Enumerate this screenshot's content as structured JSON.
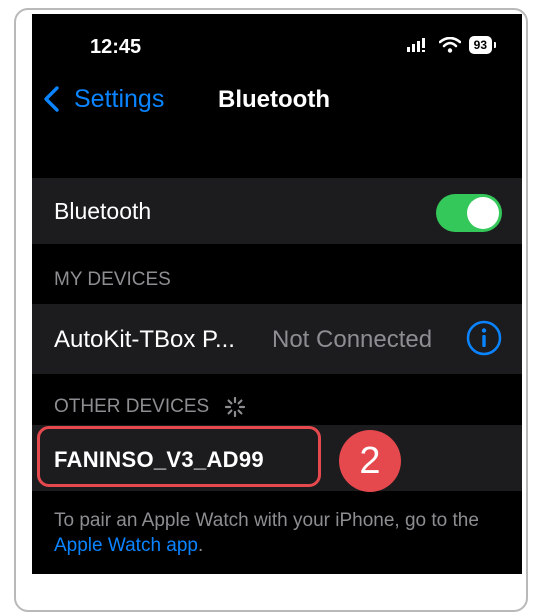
{
  "status_bar": {
    "time": "12:45",
    "battery": "93",
    "signal_icon": "signal-bars-icon",
    "wifi_icon": "wifi-icon"
  },
  "nav": {
    "back_label": "Settings",
    "title": "Bluetooth"
  },
  "bluetooth_row": {
    "label": "Bluetooth",
    "toggle_on": true
  },
  "my_devices": {
    "header": "MY DEVICES",
    "items": [
      {
        "name": "AutoKit-TBox P...",
        "status": "Not Connected"
      }
    ]
  },
  "other_devices": {
    "header": "OTHER DEVICES",
    "items": [
      {
        "name": "FANINSO_V3_AD99"
      }
    ]
  },
  "footer": {
    "text": "To pair an Apple Watch with your iPhone, go to the ",
    "link": "Apple Watch app",
    "suffix": "."
  },
  "annotation": {
    "step": "2"
  },
  "colors": {
    "accent": "#0a84ff",
    "toggle": "#34c759",
    "highlight": "#e5484d",
    "row_bg": "#1c1c1e"
  }
}
